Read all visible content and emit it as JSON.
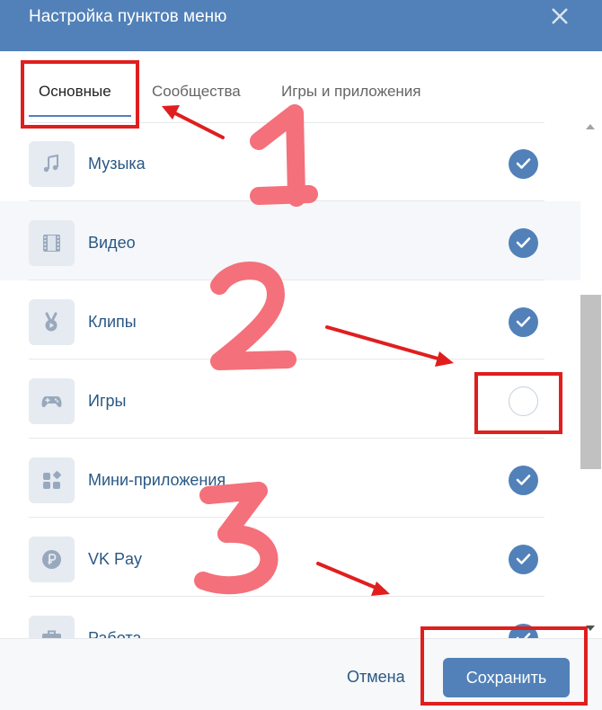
{
  "dialog": {
    "title": "Настройка пунктов меню"
  },
  "tabs": [
    {
      "label": "Основные",
      "active": true
    },
    {
      "label": "Сообщества",
      "active": false
    },
    {
      "label": "Игры и приложения",
      "active": false
    }
  ],
  "items": [
    {
      "label": "Музыка",
      "icon": "music-note-icon",
      "enabled": true
    },
    {
      "label": "Видео",
      "icon": "film-icon",
      "enabled": true
    },
    {
      "label": "Клипы",
      "icon": "clips-icon",
      "enabled": true
    },
    {
      "label": "Игры",
      "icon": "gamepad-icon",
      "enabled": false
    },
    {
      "label": "Мини-приложения",
      "icon": "mini-apps-icon",
      "enabled": true
    },
    {
      "label": "VK Pay",
      "icon": "vk-pay-icon",
      "enabled": true
    },
    {
      "label": "Работа",
      "icon": "briefcase-icon",
      "enabled": true
    }
  ],
  "footer": {
    "cancel_label": "Отмена",
    "save_label": "Сохранить"
  },
  "annotations": {
    "numbers": [
      "1",
      "2",
      "3"
    ],
    "marker_color": "#f4707a",
    "box_color": "#e01e1e"
  },
  "colors": {
    "header": "#5181b8",
    "accent": "#5181b8",
    "link": "#2a5885"
  }
}
